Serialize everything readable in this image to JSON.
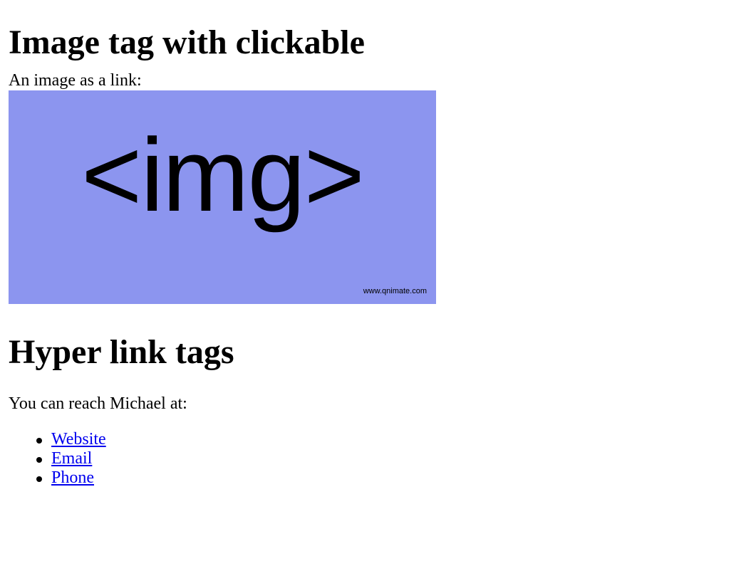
{
  "image_section": {
    "heading": "Image tag with clickable",
    "intro": "An image as a link:",
    "image": {
      "text": "<img>",
      "credit": "www.qnimate.com",
      "background": "#8c95ef"
    }
  },
  "links_section": {
    "heading": "Hyper link tags",
    "intro": "You can reach Michael at:",
    "links": [
      {
        "label": "Website"
      },
      {
        "label": "Email"
      },
      {
        "label": "Phone"
      }
    ],
    "link_color": "#0000ee"
  }
}
